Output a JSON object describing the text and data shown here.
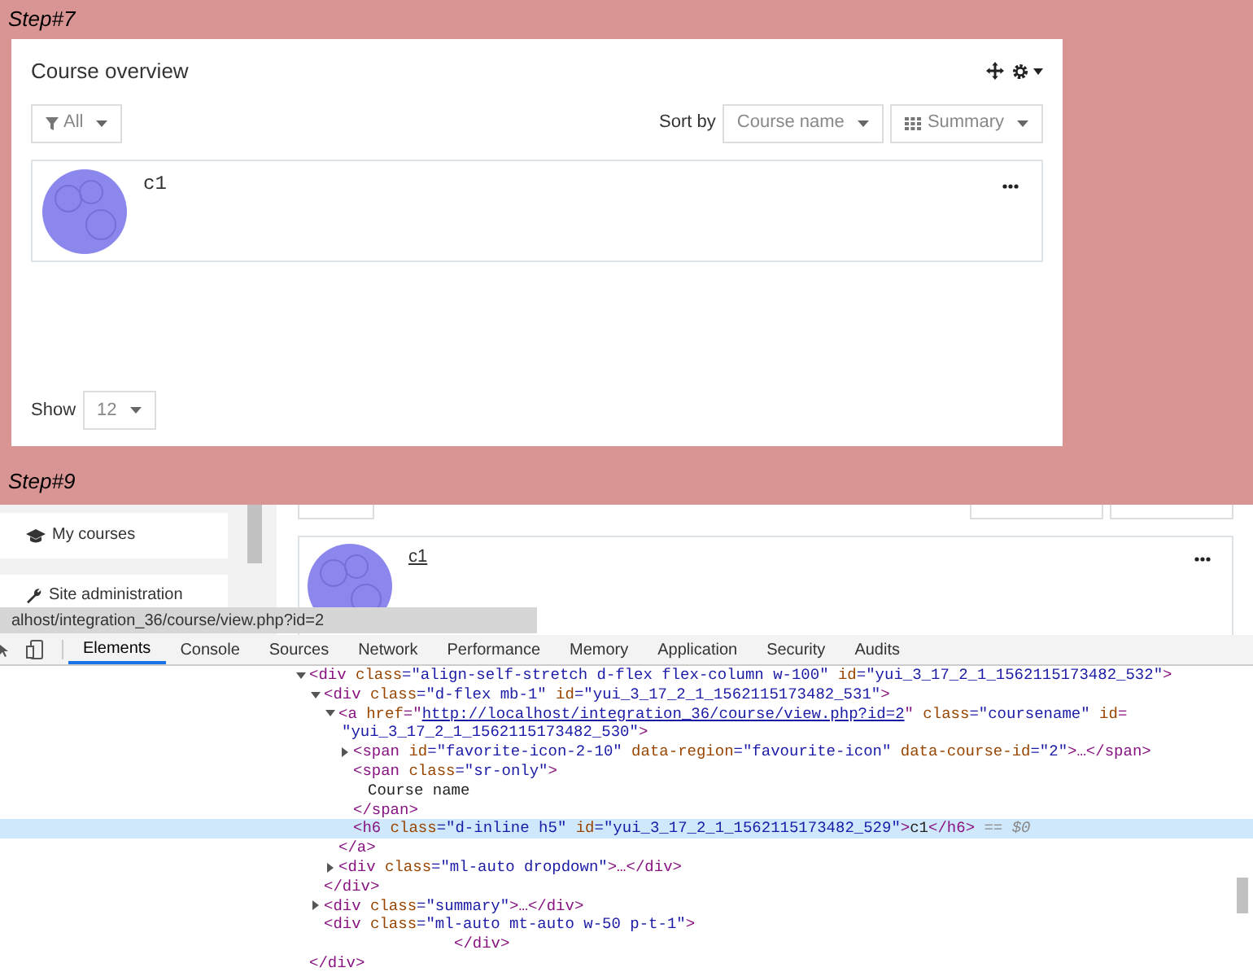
{
  "step_top": {
    "label": "Step#7"
  },
  "course_overview": {
    "title": "Course overview",
    "filter": {
      "label": "All"
    },
    "sort_label": "Sort by",
    "sort": {
      "label": "Course name"
    },
    "view": {
      "label": "Summary"
    },
    "courses": [
      {
        "name": "c1"
      }
    ],
    "show_label": "Show",
    "show": {
      "label": "12"
    }
  },
  "step_bottom": {
    "label": "Step#9"
  },
  "sidebar": {
    "items": [
      {
        "label": "My courses",
        "kind": "courses"
      },
      {
        "label": "Site administration",
        "kind": "admin"
      }
    ]
  },
  "page_courses": [
    {
      "name": "c1"
    }
  ],
  "link_tooltip": "alhost/integration_36/course/view.php?id=2",
  "devtools": {
    "tabs": [
      {
        "label": "Elements",
        "selected": true
      },
      {
        "label": "Console",
        "selected": false
      },
      {
        "label": "Sources",
        "selected": false
      },
      {
        "label": "Network",
        "selected": false
      },
      {
        "label": "Performance",
        "selected": false
      },
      {
        "label": "Memory",
        "selected": false
      },
      {
        "label": "Application",
        "selected": false
      },
      {
        "label": "Security",
        "selected": false
      },
      {
        "label": "Audits",
        "selected": false
      }
    ],
    "tree": [
      {
        "selected": false,
        "expanded": true,
        "lines": [
          [
            {
              "kind": "tag",
              "text": "<div"
            },
            {
              "kind": "attr",
              "text": " class"
            },
            {
              "kind": "value",
              "text": "=\"align-self-stretch d-flex flex-column w-100\""
            },
            {
              "kind": "attr",
              "text": " id"
            },
            {
              "kind": "value",
              "text": "=\"yui_3_17_2_1_1562115173482_532\""
            },
            {
              "kind": "tag",
              "text": ">"
            }
          ]
        ],
        "children": [
          {
            "selected": false,
            "expanded": true,
            "lines": [
              [
                {
                  "kind": "tag",
                  "text": "<div"
                },
                {
                  "kind": "attr",
                  "text": " class"
                },
                {
                  "kind": "value",
                  "text": "=\"d-flex mb-1\""
                },
                {
                  "kind": "attr",
                  "text": " id"
                },
                {
                  "kind": "value",
                  "text": "=\"yui_3_17_2_1_1562115173482_531\""
                },
                {
                  "kind": "tag",
                  "text": ">"
                }
              ]
            ],
            "children": [
              {
                "selected": false,
                "expanded": true,
                "lines": [
                  [
                    {
                      "kind": "tag",
                      "text": "<a"
                    },
                    {
                      "kind": "attr",
                      "text": " href"
                    },
                    {
                      "kind": "tag",
                      "text": "=\""
                    },
                    {
                      "kind": "link",
                      "text": "http://localhost/integration_36/course/view.php?id=2"
                    },
                    {
                      "kind": "tag",
                      "text": "\""
                    },
                    {
                      "kind": "attr",
                      "text": " class"
                    },
                    {
                      "kind": "value",
                      "text": "=\"coursename\""
                    },
                    {
                      "kind": "attr",
                      "text": " id"
                    },
                    {
                      "kind": "tag",
                      "text": "="
                    }
                  ],
                  [
                    {
                      "kind": "value",
                      "text": "\"yui_3_17_2_1_1562115173482_530\""
                    },
                    {
                      "kind": "tag",
                      "text": ">"
                    }
                  ]
                ],
                "closing": "</a>",
                "children": [
                  {
                    "selected": false,
                    "expanded": false,
                    "lines": [
                      [
                        {
                          "kind": "tag",
                          "text": "<span"
                        },
                        {
                          "kind": "attr",
                          "text": " id"
                        },
                        {
                          "kind": "value",
                          "text": "=\"favorite-icon-2-10\""
                        },
                        {
                          "kind": "attr",
                          "text": " data-region"
                        },
                        {
                          "kind": "value",
                          "text": "=\"favourite-icon\""
                        },
                        {
                          "kind": "attr",
                          "text": " data-course-id"
                        },
                        {
                          "kind": "value",
                          "text": "=\"2\""
                        },
                        {
                          "kind": "tag",
                          "text": ">…</span>"
                        }
                      ]
                    ]
                  },
                  {
                    "selected": false,
                    "lines": [
                      [
                        {
                          "kind": "tag",
                          "text": "<span"
                        },
                        {
                          "kind": "attr",
                          "text": " class"
                        },
                        {
                          "kind": "value",
                          "text": "=\"sr-only\""
                        },
                        {
                          "kind": "tag",
                          "text": ">"
                        }
                      ]
                    ],
                    "closing": "</span>",
                    "children": [
                      {
                        "selected": false,
                        "lines": [
                          [
                            {
                              "kind": "plain",
                              "text": "Course name"
                            }
                          ]
                        ]
                      }
                    ]
                  },
                  {
                    "selected": true,
                    "lines": [
                      [
                        {
                          "kind": "tag",
                          "text": "<h6"
                        },
                        {
                          "kind": "attr",
                          "text": " class"
                        },
                        {
                          "kind": "value",
                          "text": "=\"d-inline h5\""
                        },
                        {
                          "kind": "attr",
                          "text": " id"
                        },
                        {
                          "kind": "value",
                          "text": "=\"yui_3_17_2_1_1562115173482_529\""
                        },
                        {
                          "kind": "tag",
                          "text": ">"
                        },
                        {
                          "kind": "plain",
                          "text": "c1"
                        },
                        {
                          "kind": "tag",
                          "text": "</h6>"
                        },
                        {
                          "kind": "muted",
                          "text": " == $0"
                        }
                      ]
                    ]
                  }
                ]
              },
              {
                "selected": false,
                "expanded": false,
                "lines": [
                  [
                    {
                      "kind": "tag",
                      "text": "<div"
                    },
                    {
                      "kind": "attr",
                      "text": " class"
                    },
                    {
                      "kind": "value",
                      "text": "=\"ml-auto dropdown\""
                    },
                    {
                      "kind": "tag",
                      "text": ">…</div>"
                    }
                  ]
                ]
              }
            ],
            "closing": "</div>"
          },
          {
            "selected": false,
            "expanded": false,
            "lines": [
              [
                {
                  "kind": "tag",
                  "text": "<div"
                },
                {
                  "kind": "attr",
                  "text": " class"
                },
                {
                  "kind": "value",
                  "text": "=\"summary\""
                },
                {
                  "kind": "tag",
                  "text": ">…</div>"
                }
              ]
            ]
          },
          {
            "selected": false,
            "lines": [
              [
                {
                  "kind": "tag",
                  "text": "<div"
                },
                {
                  "kind": "attr",
                  "text": " class"
                },
                {
                  "kind": "value",
                  "text": "=\"ml-auto mt-auto w-50 p-t-1\""
                },
                {
                  "kind": "tag",
                  "text": ">"
                }
              ]
            ],
            "closing": "</div>"
          }
        ],
        "closing": "</div>"
      }
    ]
  }
}
